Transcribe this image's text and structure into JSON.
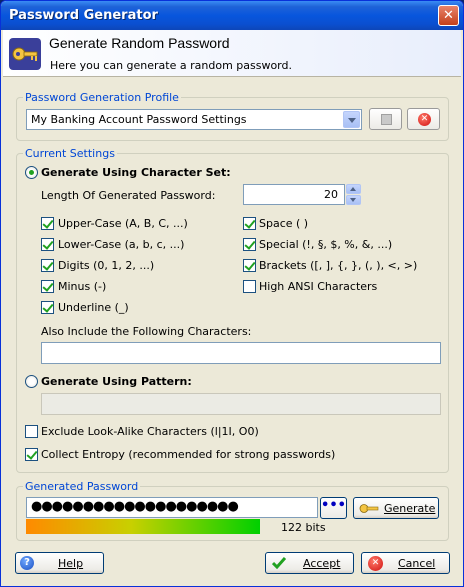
{
  "window": {
    "title": "Password Generator",
    "close_glyph": "✕"
  },
  "header": {
    "title": "Generate Random Password",
    "subtitle": "Here you can generate a random password.",
    "icon": "key-icon"
  },
  "profile": {
    "legend": "Password Generation Profile",
    "selected": "My Banking Account Password Settings",
    "save_icon": "disk-icon",
    "delete_icon": "delete-icon",
    "delete_glyph": "✕"
  },
  "settings": {
    "legend": "Current Settings",
    "charset_mode_label": "Generate Using Character Set:",
    "length_label": "Length Of Generated Password:",
    "length_value": "20",
    "options_left": [
      {
        "label": "Upper-Case (A, B, C, ...)",
        "checked": true
      },
      {
        "label": "Lower-Case (a, b, c, ...)",
        "checked": true
      },
      {
        "label": "Digits (0, 1, 2, ...)",
        "checked": true
      },
      {
        "label": "Minus (-)",
        "checked": true
      },
      {
        "label": "Underline (_)",
        "checked": true
      }
    ],
    "options_right": [
      {
        "label": "Space ( )",
        "checked": true
      },
      {
        "label": "Special (!, §, $, %, &, ...)",
        "checked": true
      },
      {
        "label": "Brackets ([, ], {, }, (, ), <, >)",
        "checked": true
      },
      {
        "label": "High ANSI Characters",
        "checked": false
      }
    ],
    "also_include_label": "Also Include the Following Characters:",
    "also_include_value": "",
    "pattern_mode_label": "Generate Using Pattern:",
    "pattern_value": "",
    "exclude_lookalike_label": "Exclude Look-Alike Characters (l|1I, O0)",
    "exclude_lookalike_checked": false,
    "collect_entropy_label": "Collect Entropy (recommended for strong passwords)",
    "collect_entropy_checked": true
  },
  "generated": {
    "legend": "Generated Password",
    "password_mask": "●●●●●●●●●●●●●●●●●●●●",
    "toggle_label": "•••",
    "generate_label": "Generate",
    "quality_bits": "122 bits"
  },
  "footer": {
    "help_label": "Help",
    "accept_label": "Accept",
    "cancel_label": "Cancel",
    "help_glyph": "?",
    "cancel_glyph": "✕"
  }
}
